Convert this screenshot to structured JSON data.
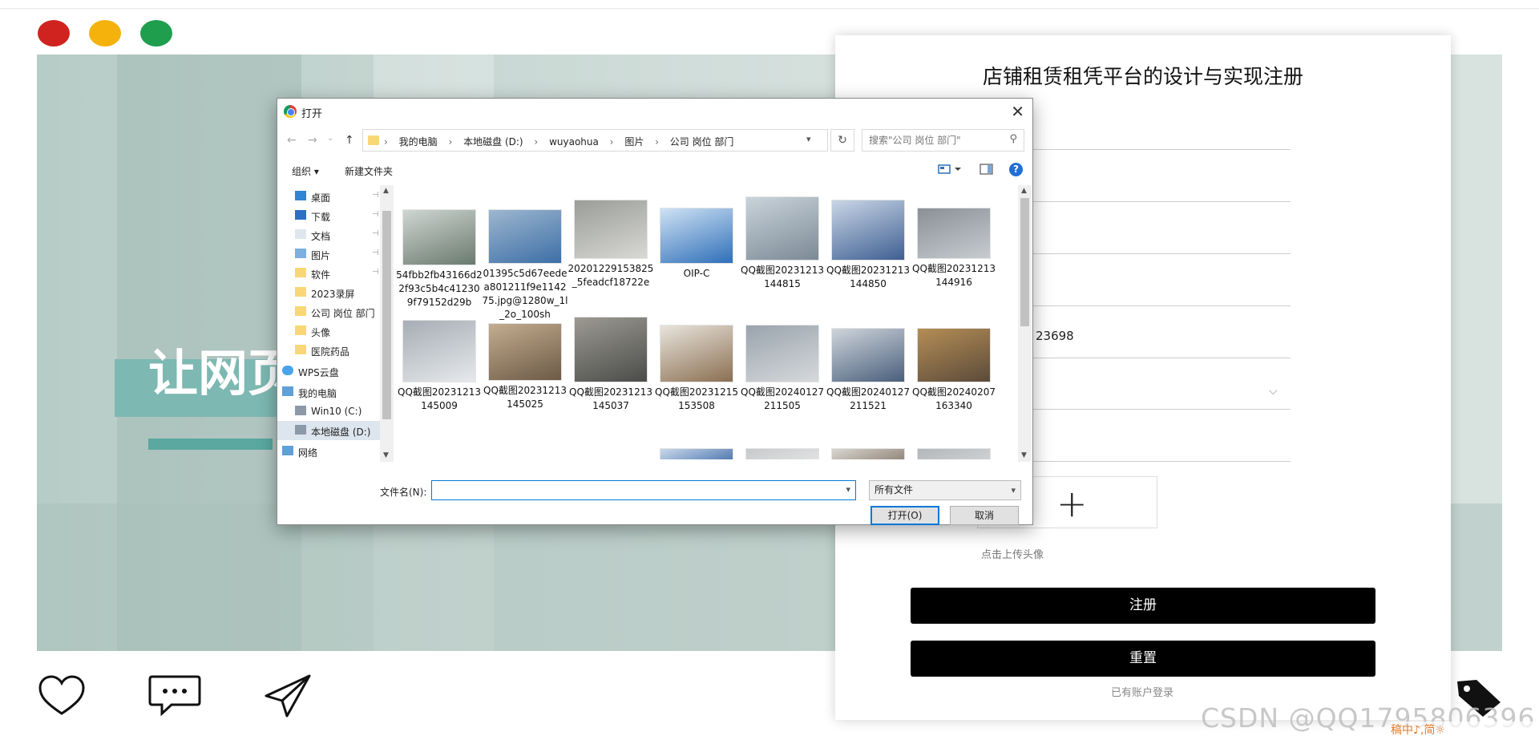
{
  "window_controls": [
    "close-dot",
    "minimize-dot",
    "maximize-dot"
  ],
  "hero": {
    "title": "让网页",
    "title_visible": "让网页"
  },
  "register": {
    "title": "店铺租赁租凭平台的设计与实现注册",
    "phone_partial": "23698",
    "upload_plus": "+",
    "upload_label": "点击上传头像",
    "register_button": "注册",
    "reset_button": "重置",
    "login_link": "已有账户登录",
    "select_chevron": "⌵"
  },
  "watermark": "CSDN @QQ1795806396",
  "ime_bar": "稿中♪,简☼",
  "dialog": {
    "title": "打开",
    "close": "✕",
    "nav": {
      "back": "←",
      "forward": "→",
      "recent": "⌄",
      "up": "↑"
    },
    "breadcrumb": [
      "我的电脑",
      "本地磁盘 (D:)",
      "wuyaohua",
      "图片",
      "公司 岗位 部门"
    ],
    "breadcrumb_sep": "›",
    "refresh": "↻",
    "search_placeholder": "搜索\"公司 岗位 部门\"",
    "toolbar": {
      "organize": "组织 ▾",
      "new_folder": "新建文件夹",
      "help": "?"
    },
    "sidebar": [
      {
        "label": "桌面",
        "icon": "desktop-icon",
        "pinned": true
      },
      {
        "label": "下载",
        "icon": "download-icon",
        "pinned": true
      },
      {
        "label": "文档",
        "icon": "document-icon",
        "pinned": true
      },
      {
        "label": "图片",
        "icon": "pictures-icon",
        "pinned": true
      },
      {
        "label": "软件",
        "icon": "folder-icon",
        "pinned": true
      },
      {
        "label": "2023录屏",
        "icon": "folder-icon",
        "pinned": false
      },
      {
        "label": "公司 岗位 部门",
        "icon": "folder-icon",
        "pinned": false
      },
      {
        "label": "头像",
        "icon": "folder-icon",
        "pinned": false
      },
      {
        "label": "医院药品",
        "icon": "folder-icon",
        "pinned": false
      },
      {
        "label": "WPS云盘",
        "icon": "cloud-icon",
        "pinned": false
      },
      {
        "label": "我的电脑",
        "icon": "computer-icon",
        "pinned": false
      },
      {
        "label": "Win10 (C:)",
        "icon": "drive-icon",
        "pinned": false
      },
      {
        "label": "本地磁盘 (D:)",
        "icon": "drive-icon",
        "pinned": false,
        "selected": true
      },
      {
        "label": "网络",
        "icon": "network-icon",
        "pinned": false
      }
    ],
    "pin_glyph": "📌",
    "files_row1": [
      {
        "name": "54fbb2fb43166d22f93c5b4c412309f79152d29b",
        "colors": [
          "#6a7a6e",
          "#cfd6d2"
        ]
      },
      {
        "name": "01395c5d67eedea801211f9e114275.jpg@1280w_1l_2o_100sh",
        "colors": [
          "#3d6fa6",
          "#9db6cf"
        ]
      },
      {
        "name": "20201229153825_5feadcf18722e",
        "colors": [
          "#d8d8d4",
          "#9a9d98"
        ]
      },
      {
        "name": "OIP-C",
        "colors": [
          "#2f6fb8",
          "#cfe2f4"
        ]
      },
      {
        "name": "QQ截图20231213144815",
        "colors": [
          "#7c8a96",
          "#c9d3da"
        ]
      },
      {
        "name": "QQ截图20231213144850",
        "colors": [
          "#3f5f92",
          "#c9d6e6"
        ]
      },
      {
        "name": "QQ截图20231213144916",
        "colors": [
          "#c7ccd0",
          "#8a9097"
        ]
      }
    ],
    "files_row2": [
      {
        "name": "QQ截图20231213145009",
        "colors": [
          "#e6e9ec",
          "#a6adb4"
        ]
      },
      {
        "name": "QQ截图20231213145025",
        "colors": [
          "#6d5a46",
          "#c3ad90"
        ]
      },
      {
        "name": "QQ截图20231213145037",
        "colors": [
          "#4b4c4a",
          "#9c9a92"
        ]
      },
      {
        "name": "QQ截图20231215153508",
        "colors": [
          "#8b6f52",
          "#e8e4dc"
        ]
      },
      {
        "name": "QQ截图20240127211505",
        "colors": [
          "#d6d9dc",
          "#9aa4ad"
        ]
      },
      {
        "name": "QQ截图20240127211521",
        "colors": [
          "#4a5f7c",
          "#cfd5db"
        ]
      },
      {
        "name": "QQ截图20240207163340",
        "colors": [
          "#5b4b3a",
          "#b58d55"
        ]
      }
    ],
    "files_row3_colors": [
      [
        "#2f5ea1",
        "#c9d8ea"
      ],
      [
        "#e9eaea",
        "#c7c9cb"
      ],
      [
        "#7d6e60",
        "#d9d6d1"
      ],
      [
        "#d7d9da",
        "#b3b7ba"
      ]
    ],
    "filename_label": "文件名(N):",
    "filename_value": "",
    "filetype": "所有文件",
    "open_button": "打开(O)",
    "cancel_button": "取消"
  },
  "colors": {
    "red": "#d0231f",
    "yellow": "#f5b10c",
    "green": "#1f9e4e",
    "teal": "#5aa8a0"
  }
}
